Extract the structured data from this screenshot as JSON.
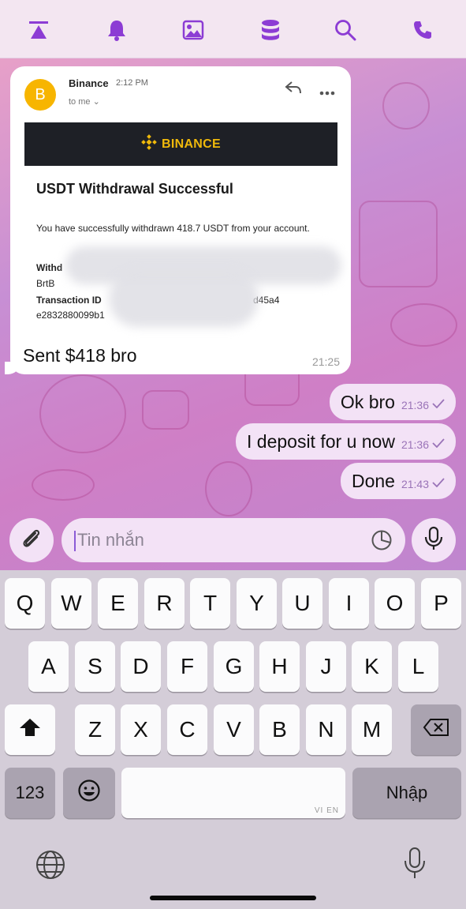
{
  "toolbar": {
    "icons": [
      "top-align-icon",
      "bell-icon",
      "image-icon",
      "database-icon",
      "search-icon",
      "phone-icon"
    ],
    "accent": "#8c3cd4"
  },
  "email": {
    "avatar_letter": "B",
    "sender": "Binance",
    "time": "2:12 PM",
    "recipient": "to me",
    "banner": "BINANCE",
    "title": "USDT Withdrawal Successful",
    "body": "You have successfully withdrawn 418.7 USDT from your account.",
    "withdrawal_label": "Withd",
    "withdrawal_value_visible": "BrtB",
    "transaction_label": "Transaction ID",
    "transaction_tail": "d45a4",
    "transaction_line2": "e2832880099b1"
  },
  "messages": {
    "incoming": {
      "text": "Sent $418 bro",
      "time": "21:25"
    },
    "outgoing": [
      {
        "text": "Ok bro",
        "time": "21:36"
      },
      {
        "text": "I deposit for u now",
        "time": "21:36"
      },
      {
        "text": "Done",
        "time": "21:43"
      }
    ]
  },
  "composer": {
    "placeholder": "Tin nhắn"
  },
  "keyboard": {
    "row1": [
      "Q",
      "W",
      "E",
      "R",
      "T",
      "Y",
      "U",
      "I",
      "O",
      "P"
    ],
    "row2": [
      "A",
      "S",
      "D",
      "F",
      "G",
      "H",
      "J",
      "K",
      "L"
    ],
    "row3": [
      "Z",
      "X",
      "C",
      "V",
      "B",
      "N",
      "M"
    ],
    "numbers_label": "123",
    "return_label": "Nhập",
    "space_language": "VI EN"
  },
  "colors": {
    "bubble_out": "#f3e2f6",
    "time_out": "#9a73b8",
    "binance_yellow": "#f0b90b"
  }
}
